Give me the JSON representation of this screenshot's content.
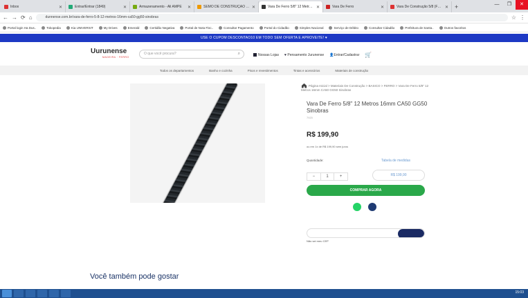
{
  "browser": {
    "tabs": [
      {
        "title": "Inbox",
        "color": "#d33"
      },
      {
        "title": "Entrar/Entrar (1849)",
        "color": "#2a7"
      },
      {
        "title": "Armazenamento - Ali AMPE",
        "color": "#7a1"
      },
      {
        "title": "SEMO DE CONSTRUÇÃO DE S..",
        "color": "#e90"
      },
      {
        "title": "Vara De Ferro 5/8\" 12 Metros 16...",
        "color": "#333"
      },
      {
        "title": "Vara De Ferro",
        "color": "#c22"
      },
      {
        "title": "Vara De Construção 5/8 (Ferr...",
        "color": "#d33"
      }
    ],
    "new_tab": "+",
    "url": "dunnense.com.br/vara-de-ferro-5-8-12-metros-16mm-ca50-gg50-sinobras",
    "bookmarks": [
      "Portal login Ha Dus..",
      "Tokopedia",
      "Kia UNIVERSIT",
      "My Drives",
      "Emerald",
      "Certidão Negativa",
      "Portal de Nota Fisc..",
      "Consultar Pagamento",
      "Portal do Cidadão",
      "Simples Nacional",
      "Serviço de Débito",
      "Consultar Cidadão",
      "Prefeitura de Santa..",
      "Outros favoritos"
    ]
  },
  "promo": "USE O CUPOM DESCONTAO10 EM TODO SEM OFERTA E APROVEITE! ♥",
  "header": {
    "logo": "Uurunense",
    "logo_sub": "MADEIRA · FERRO",
    "search_placeholder": "O que você procura?",
    "links": [
      "Nossas Lojas",
      "Pensamento Jurunense",
      "Entrar/Cadastrar"
    ]
  },
  "categories": [
    "Todos os departamentos",
    "Banho e cozinha",
    "Pisos e revestimentos",
    "Tintas e acessórios",
    "Materiais de construção"
  ],
  "product": {
    "breadcrumb": "Página Inicial > Materiais De Construção > BASICO > FERRO > Vara De Ferro 5/8\" 12 Metros 16mm CA50 GG50 Sinobras",
    "title": "Vara De Ferro 5/8\" 12 Metros 16mm CA50 GG50 Sinobras",
    "sku": "7920",
    "price": "R$ 199,90",
    "pix_note": "ou em 1x de R$ 199,90 sem juros",
    "qty_label": "Quantidade:",
    "table_link": "Tabela de medidas",
    "qty_value": "1",
    "unit_price": "R$ 199,90",
    "buy_label": "COMPRAR AGORA",
    "cep_link": "Não sei meu CEP"
  },
  "also_like": "Você também pode gostar",
  "taskbar_clock": "15:03"
}
